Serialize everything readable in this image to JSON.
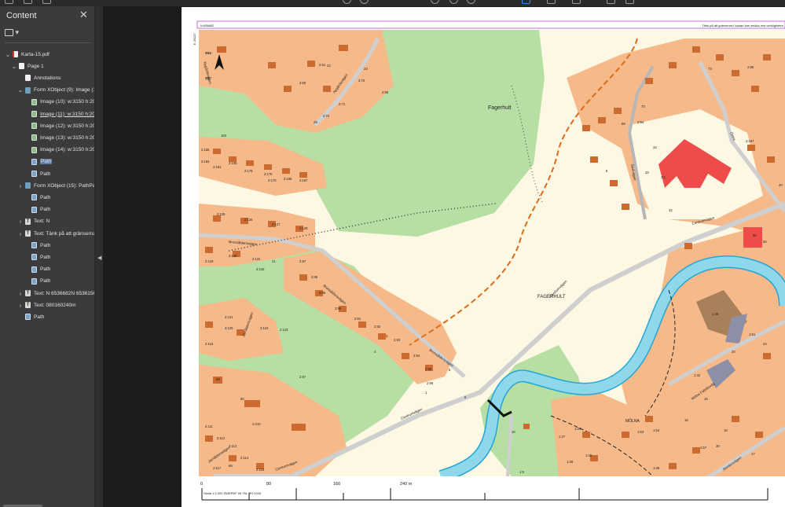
{
  "panel": {
    "title": "Content",
    "close_glyph": "✕",
    "options_glyph": "▾",
    "tree": [
      {
        "label": "Karta-15.pdf",
        "icon": "pdf-file-icon",
        "depth": 0,
        "twisty": "expanded"
      },
      {
        "label": "Page 1",
        "icon": "page-icon",
        "depth": 1,
        "twisty": "expanded"
      },
      {
        "label": "Annotations",
        "icon": "page-icon",
        "depth": 2,
        "twisty": "none"
      },
      {
        "label": "Form XObject (9): Image (10): \\",
        "icon": "form-xobject-icon",
        "depth": 2,
        "twisty": "expanded"
      },
      {
        "label": "Image (10): w:3150 h:2071",
        "icon": "image-icon",
        "depth": 3,
        "twisty": "none"
      },
      {
        "label": "Image (11): w:3150 h:2071",
        "icon": "image-icon",
        "depth": 3,
        "twisty": "none",
        "underline": true
      },
      {
        "label": "Image (12): w:3150 h:2071",
        "icon": "image-icon",
        "depth": 3,
        "twisty": "none"
      },
      {
        "label": "Image (13): w:3150 h:2071",
        "icon": "image-icon",
        "depth": 3,
        "twisty": "none"
      },
      {
        "label": "Image (14): w:3150 h:2071",
        "icon": "image-icon",
        "depth": 3,
        "twisty": "none"
      },
      {
        "label": "Path",
        "icon": "path-icon",
        "depth": 3,
        "twisty": "none",
        "selected": true
      },
      {
        "label": "Path",
        "icon": "path-icon",
        "depth": 3,
        "twisty": "none"
      },
      {
        "label": "Form XObject (15): PathPat",
        "icon": "form-xobject-icon",
        "depth": 2,
        "twisty": "collapsed"
      },
      {
        "label": "Path",
        "icon": "path-icon",
        "depth": 3,
        "twisty": "none"
      },
      {
        "label": "Path",
        "icon": "path-icon",
        "depth": 3,
        "twisty": "none"
      },
      {
        "label": "Text: N",
        "icon": "text-icon",
        "depth": 2,
        "twisty": "collapsed"
      },
      {
        "label": "Text: Tänk på att gränserna",
        "icon": "text-icon",
        "depth": 2,
        "twisty": "collapsed"
      },
      {
        "label": "Path",
        "icon": "path-icon",
        "depth": 3,
        "twisty": "none"
      },
      {
        "label": "Path",
        "icon": "path-icon",
        "depth": 3,
        "twisty": "none"
      },
      {
        "label": "Path",
        "icon": "path-icon",
        "depth": 3,
        "twisty": "none"
      },
      {
        "label": "Path",
        "icon": "path-icon",
        "depth": 3,
        "twisty": "none"
      },
      {
        "label": "Text: N 6536682N 6536156",
        "icon": "text-icon",
        "depth": 2,
        "twisty": "collapsed"
      },
      {
        "label": "Text: 080160240m",
        "icon": "text-icon",
        "depth": 2,
        "twisty": "collapsed"
      },
      {
        "label": "Path",
        "icon": "path-icon",
        "depth": 2,
        "twisty": "none"
      }
    ]
  },
  "colors": {
    "forest": "#b7dfa4",
    "meadow": "#fdf8e3",
    "plot": "#f6b98a",
    "house": "#cc6a2f",
    "water": "#8fd7ea",
    "water_edge": "#24a7d4",
    "road": "#cfcfcf",
    "red_building": "#ee4b4b",
    "orange_path": "#e06a1a",
    "selection_frame": "#b04fc7"
  },
  "map": {
    "header_left": "N 6536682",
    "header_right": "Tänk på att gränserna i kartan kan avvika mot verkligheten",
    "coord_left": "E 150227",
    "place_fagerhult": "Fagerhult",
    "place_fagerhult_caps": "FAGERHULT",
    "place_molna": "MÖLNA",
    "street_centrum_1": "Centrumvägen",
    "street_centrum_2": "Centrumvägen",
    "street_centrum_3": "Centrumvägen",
    "street_centrum_4": "Centrumvägen",
    "street_bronsaldersv": "Bronsåldersvägen",
    "street_bronsaldersv_2": "Bronsåldersvägen",
    "street_bronsaldersv_3": "Bronsåldersvägen",
    "street_nygardsv": "Nygårdsvägen",
    "street_nygardsv_2": "Nygårdsvägen",
    "street_ostra": "Östra",
    "street_molna": "Mölna Fabriksväg",
    "street_stenbrovagen": "Stenbrovägen",
    "street_jarnaldersv": "Järnåldersvägen",
    "street_jarnaldersv_2": "Järnåldersvägen",
    "street_skolvagen": "Skolvägen",
    "parcels": [
      "2:56",
      "2:57",
      "2:61",
      "2:60",
      "2:70",
      "2:69",
      "2:71",
      "2:72",
      "29",
      "23",
      "22",
      "163",
      "2:155",
      "2:165",
      "2:175",
      "2:176",
      "2:170",
      "2:166",
      "2:167",
      "2:181",
      "2:184",
      "2:125",
      "2:126",
      "2:127",
      "2:128",
      "2:129",
      "2:130",
      "2:131",
      "2:132",
      "2:87",
      "2:88",
      "2:89",
      "2:90",
      "2:91",
      "2:92",
      "2:93",
      "2:94",
      "2:95",
      "2:96",
      "2:121",
      "2:120",
      "2:119",
      "2:122",
      "2:123",
      "2:97",
      "2:210",
      "2:111",
      "2:112",
      "2:113",
      "2:114",
      "2:115",
      "2:117",
      "2:94",
      "3:1",
      "2:86",
      "2:187",
      "1:49",
      "1:51",
      "1:42",
      "1:29",
      "1:27",
      "1:28",
      "1:30",
      "1:48",
      "1:53",
      "1:54",
      "1:57",
      "1:9",
      "35",
      "21",
      "1",
      "3",
      "4",
      "5",
      "8",
      "9",
      "10",
      "15",
      "16",
      "18",
      "17",
      "20",
      "24",
      "30",
      "32",
      "33",
      "34",
      "40",
      "50",
      "58",
      "60",
      "65",
      "68",
      "70",
      "73",
      "75",
      "78"
    ]
  },
  "scale": {
    "ticks": [
      "0",
      "80",
      "160",
      "240 m"
    ],
    "caption": "Skala 1:2 000   SWEREF 99 TM, RH 2000"
  }
}
